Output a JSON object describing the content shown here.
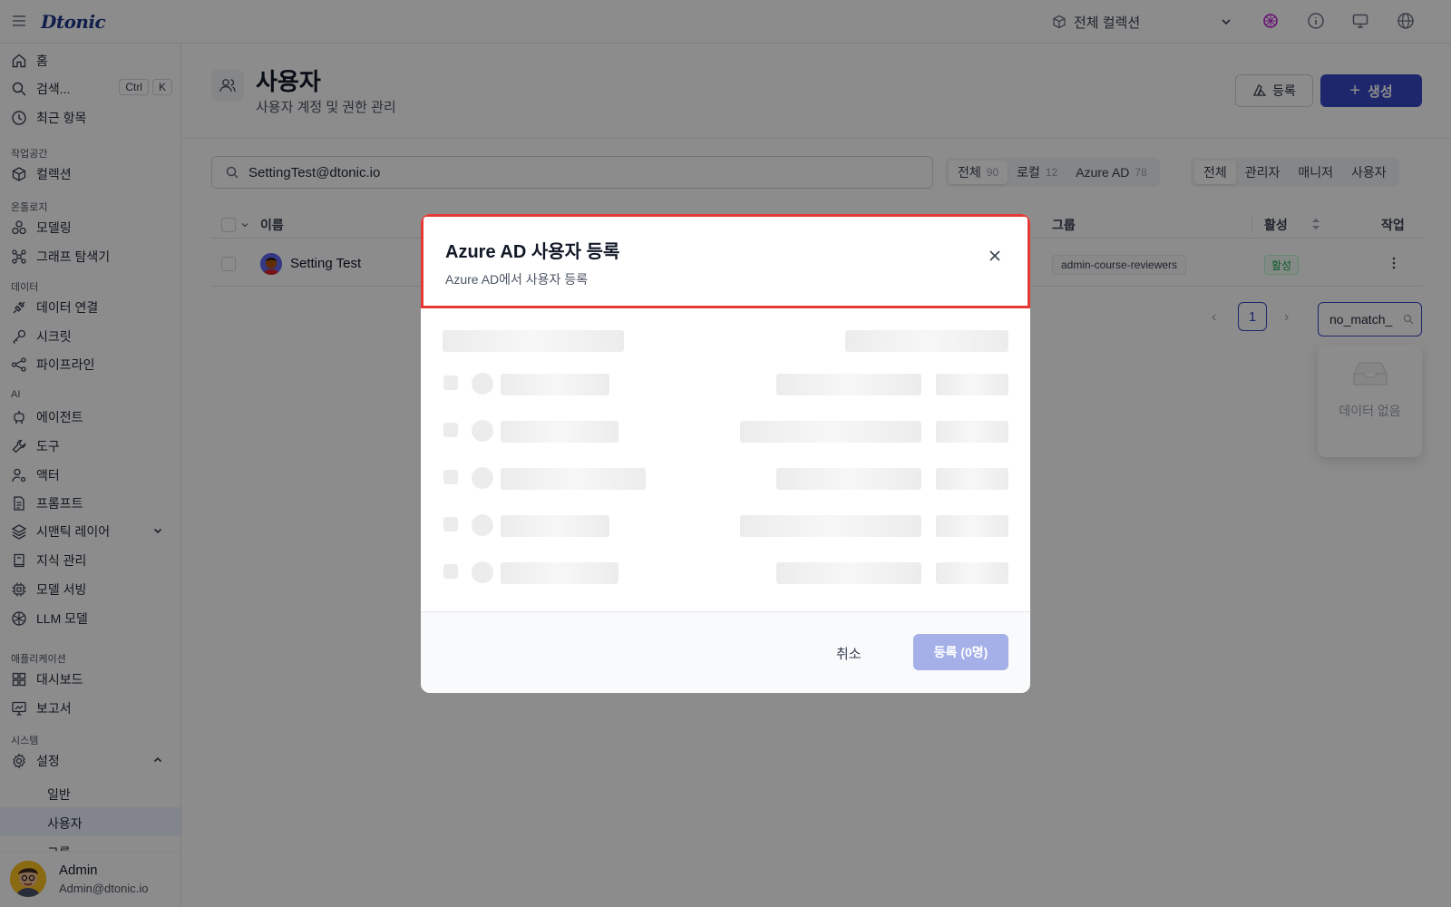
{
  "app": {
    "logo": "Dtonic"
  },
  "topbar": {
    "collection_label": "전체 컬렉션",
    "icons": [
      "menu-icon",
      "cube-icon",
      "chevron-down-icon",
      "brand-icon",
      "info-icon",
      "monitor-icon",
      "globe-icon"
    ]
  },
  "sidebar": {
    "home": "홈",
    "search": "검색...",
    "search_kbd": [
      "Ctrl",
      "K"
    ],
    "recent": "최근 항목",
    "sections": {
      "workspace": "작업공간",
      "ontology": "온톨로지",
      "data": "데이터",
      "ai": "AI",
      "applications": "애플리케이션",
      "system": "시스템"
    },
    "collection": "컬렉션",
    "modeling": "모델링",
    "graph_explorer": "그래프 탐색기",
    "data_connection": "데이터 연결",
    "secret": "시크릿",
    "pipeline": "파이프라인",
    "agent": "에이전트",
    "tool": "도구",
    "actor": "액터",
    "prompt": "프롬프트",
    "semantic_layer": "시맨틱 레이어",
    "knowledge": "지식 관리",
    "model_serving": "모델 서빙",
    "llm_model": "LLM 모델",
    "dashboard": "대시보드",
    "report": "보고서",
    "settings": "설정",
    "settings_sub": [
      "일반",
      "사용자",
      "그룹"
    ],
    "user": {
      "name": "Admin",
      "email": "Admin@dtonic.io"
    }
  },
  "page": {
    "title": "사용자",
    "subtitle": "사용자 계정 및 권한 관리",
    "register_button": "등록",
    "create_button": "생성"
  },
  "filters": {
    "search_value": "SettingTest@dtonic.io",
    "source_tabs": [
      {
        "label": "전체",
        "count": "90"
      },
      {
        "label": "로컬",
        "count": "12"
      },
      {
        "label": "Azure AD",
        "count": "78"
      }
    ],
    "role_tabs": [
      "전체",
      "관리자",
      "매니저",
      "사용자"
    ]
  },
  "table": {
    "columns": {
      "name": "이름",
      "group": "그룹",
      "active": "활성",
      "action": "작업"
    },
    "rows": [
      {
        "name": "Setting Test",
        "group": "admin-course-reviewers",
        "status": "활성"
      }
    ]
  },
  "pagination": {
    "current": "1"
  },
  "column_filter": {
    "value": "no_match_",
    "empty_text": "데이터 없음"
  },
  "modal": {
    "title": "Azure AD 사용자 등록",
    "description": "Azure AD에서 사용자 등록",
    "cancel": "취소",
    "submit": "등록 (0명)"
  },
  "colors": {
    "primary": "#3748c5",
    "highlight": "#e53935",
    "success": "#16a34a"
  }
}
